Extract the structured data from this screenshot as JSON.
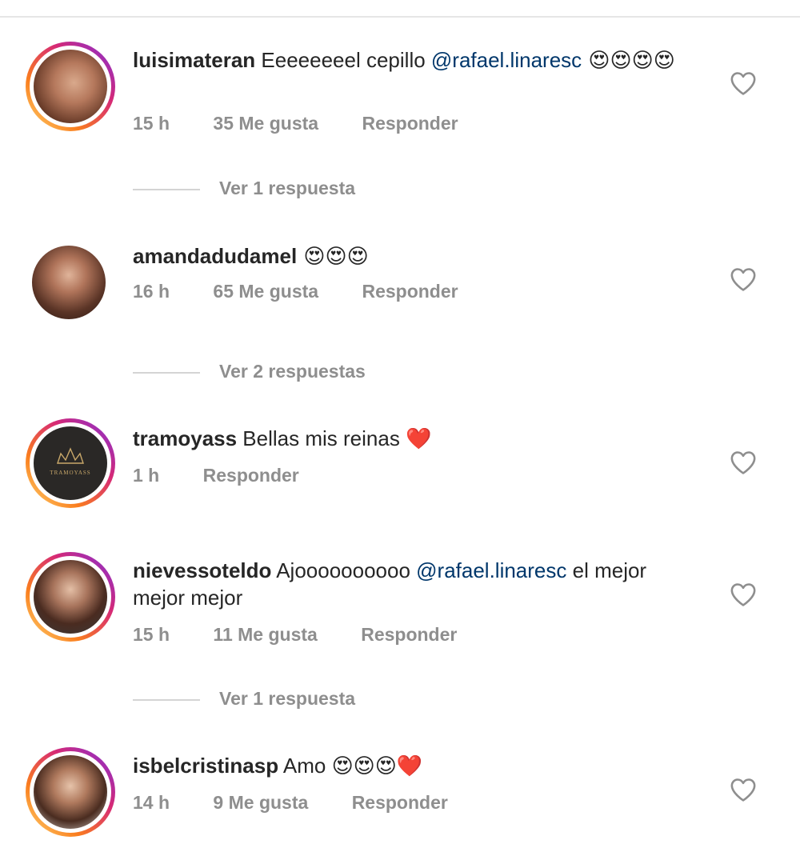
{
  "comments": [
    {
      "username": "luisimateran",
      "text": "Eeeeeeeel cepillo ",
      "mention": "@rafael.linaresc",
      "emoji_tail": " 😍😍😍😍",
      "time": "15 h",
      "likes": "35 Me gusta",
      "reply": "Responder",
      "replies_link": "Ver 1 respuesta"
    },
    {
      "username": "amandadudamel",
      "text": "",
      "emoji_tail": " 😍😍😍",
      "time": "16 h",
      "likes": "65 Me gusta",
      "reply": "Responder",
      "replies_link": "Ver 2 respuestas"
    },
    {
      "username": "tramoyass",
      "text": " Bellas mis reinas ",
      "emoji_tail": "❤️",
      "time": "1 h",
      "reply": "Responder",
      "avatar_logo_text": "TRAMOYASS"
    },
    {
      "username": "nievessoteldo",
      "text": " Ajoooooooooo ",
      "mention": "@rafael.linaresc",
      "text_after": " el mejor mejor mejor",
      "time": "15 h",
      "likes": "11 Me gusta",
      "reply": "Responder",
      "replies_link": "Ver 1 respuesta"
    },
    {
      "username": "isbelcristinasp",
      "text": " Amo ",
      "emoji_tail": "😍😍😍❤️",
      "time": "14 h",
      "likes": "9 Me gusta",
      "reply": "Responder"
    }
  ],
  "colors": {
    "username": "#262626",
    "mention": "#00376b",
    "meta": "#8e8e8e",
    "heart_outline": "#8e8e8e",
    "story_ring": "#d62976"
  },
  "icons": {
    "like": "heart-outline-icon"
  }
}
